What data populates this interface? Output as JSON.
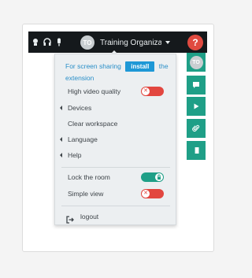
{
  "toolbar": {
    "icons": [
      "camera-icon",
      "headset-icon",
      "microphone-icon"
    ],
    "account_initials": "TO",
    "account_name": "Training Organiza...",
    "help_label": "?"
  },
  "menu": {
    "notice_before": "For screen sharing",
    "install_label": "install",
    "notice_after": "the extension",
    "high_video_quality": {
      "label": "High video quality",
      "enabled": false
    },
    "devices_label": "Devices",
    "clear_workspace_label": "Clear workspace",
    "language_label": "Language",
    "help_label": "Help",
    "lock_room": {
      "label": "Lock the room",
      "enabled": true
    },
    "simple_view": {
      "label": "Simple view",
      "enabled": false
    },
    "logout_label": "logout"
  },
  "side_panel": {
    "avatar_initials": "TO",
    "buttons": [
      "chat-icon",
      "play-icon",
      "attachment-icon",
      "notebook-icon"
    ]
  },
  "colors": {
    "accent_teal": "#1f9f87",
    "toggle_off_red": "#e2463f",
    "link_blue": "#2a8fc8",
    "topbar_dark": "#15191c",
    "help_red": "#e04a40"
  }
}
